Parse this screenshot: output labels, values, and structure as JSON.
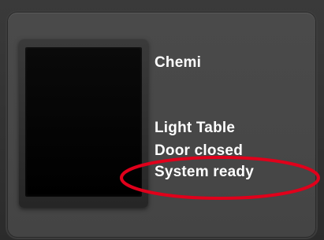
{
  "device": {
    "name": "Chemi",
    "status_lines": [
      "Light Table",
      "Door closed",
      "System ready"
    ]
  },
  "colors": {
    "panel": "#474747",
    "text": "#ffffff",
    "preview": "#000000",
    "annotation": "#e0001b"
  }
}
